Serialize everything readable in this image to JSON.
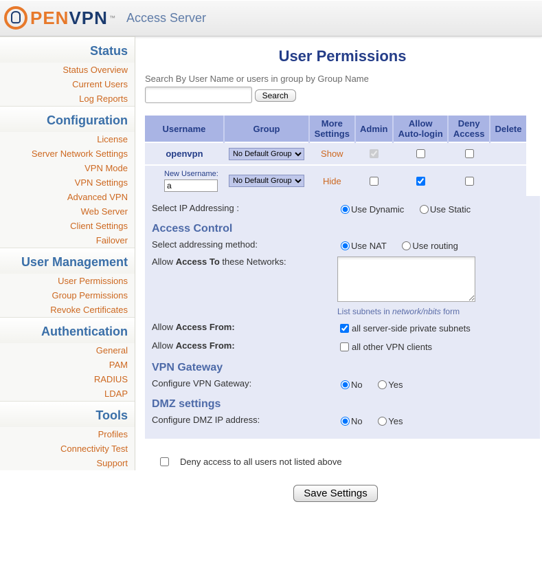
{
  "header": {
    "brand_open": "PEN",
    "brand_vpn": "VPN",
    "tm": "™",
    "subtitle": "Access Server"
  },
  "sidebar": [
    {
      "head": "Status",
      "items": [
        "Status Overview",
        "Current Users",
        "Log Reports"
      ]
    },
    {
      "head": "Configuration",
      "items": [
        "License",
        "Server Network Settings",
        "VPN Mode",
        "VPN Settings",
        "Advanced VPN",
        "Web Server",
        "Client Settings",
        "Failover"
      ]
    },
    {
      "head": "User Management",
      "items": [
        "User Permissions",
        "Group Permissions",
        "Revoke Certificates"
      ]
    },
    {
      "head": "Authentication",
      "items": [
        "General",
        "PAM",
        "RADIUS",
        "LDAP"
      ]
    },
    {
      "head": "Tools",
      "items": [
        "Profiles",
        "Connectivity Test",
        "Support"
      ]
    }
  ],
  "page_title": "User Permissions",
  "search": {
    "label": "Search By User Name or users in group by Group Name",
    "value": "",
    "button": "Search"
  },
  "table": {
    "cols": [
      "Username",
      "Group",
      "More Settings",
      "Admin",
      "Allow Auto-login",
      "Deny Access",
      "Delete"
    ],
    "rows": [
      {
        "username": "openvpn",
        "group": "No Default Group",
        "toggle": "Show",
        "admin": true,
        "autologin": false,
        "deny": false,
        "new": false
      },
      {
        "username_label": "New Username:",
        "username": "a",
        "group": "No Default Group",
        "toggle": "Hide",
        "admin": false,
        "autologin": true,
        "deny": false,
        "new": true
      }
    ]
  },
  "panel": {
    "ip_label": "Select IP Addressing :",
    "ip_dynamic": "Use Dynamic",
    "ip_static": "Use Static",
    "ip_sel": "dynamic",
    "ac_head": "Access Control",
    "ac_method_label": "Select addressing method:",
    "nat": "Use NAT",
    "routing": "Use routing",
    "ac_sel": "nat",
    "access_to_pre": "Allow ",
    "access_to_b": "Access To",
    "access_to_post": " these Networks:",
    "access_to_value": "",
    "hint_pre": "List subnets in ",
    "hint_it": "network/nbits",
    "hint_post": " form",
    "af1_pre": "Allow ",
    "af1_b": "Access From:",
    "af1_chk": true,
    "af1_txt": "all server-side private subnets",
    "af2_pre": "Allow ",
    "af2_b": "Access From:",
    "af2_chk": false,
    "af2_txt": "all other VPN clients",
    "gw_head": "VPN Gateway",
    "gw_label": "Configure VPN Gateway:",
    "gw_no": "No",
    "gw_yes": "Yes",
    "gw_sel": "no",
    "dmz_head": "DMZ settings",
    "dmz_label": "Configure DMZ IP address:",
    "dmz_no": "No",
    "dmz_yes": "Yes",
    "dmz_sel": "no"
  },
  "footer": {
    "deny_all": "Deny access to all users not listed above",
    "deny_all_chk": false,
    "save": "Save Settings"
  }
}
